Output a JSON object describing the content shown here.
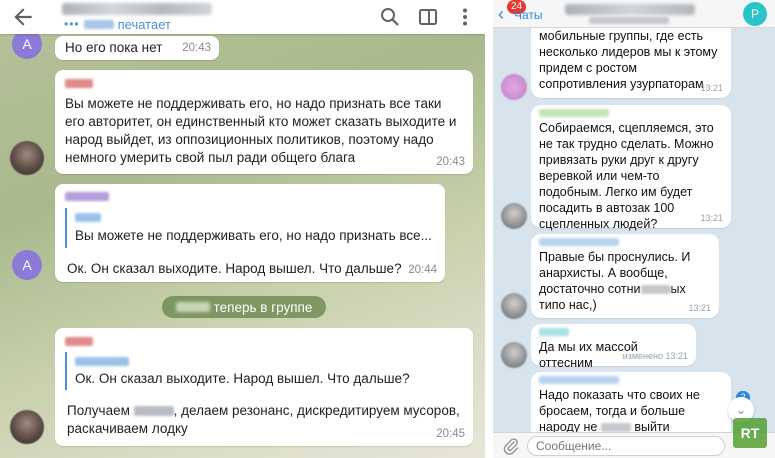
{
  "left": {
    "header": {
      "typing_label": "печатает",
      "icons": [
        "back-arrow-icon",
        "search-icon",
        "sidebar-icon",
        "more-vert-icon"
      ]
    },
    "messages": [
      {
        "avatar": "A",
        "text": "Но его пока нет",
        "time": "20:43"
      },
      {
        "text": "Вы можете не поддерживать его, но надо признать все таки его авторитет, он единственный кто может сказать выходите и народ выйдет, из оппозиционных политиков, поэтому надо немного умерить свой пыл ради общего блага",
        "time": "20:43"
      },
      {
        "avatar": "A",
        "quote": "Вы можете не поддерживать его, но надо признать все...",
        "text": "Ок. Он сказал выходите. Народ вышел. Что дальше?",
        "time": "20:44"
      },
      {
        "quote": "Ок. Он сказал выходите. Народ вышел. Что дальше?",
        "text_a": "Получаем",
        "text_b": ", делаем резонанс, дискредитируем мусоров, раскачиваем лодку",
        "time": "20:45"
      }
    ],
    "service": {
      "text": "теперь в группе"
    }
  },
  "right": {
    "header": {
      "back_label": "Чаты",
      "unread": "24",
      "avatar_letter": "Р"
    },
    "messages": [
      {
        "text": "мобильные группы, где есть несколько лидеров  мы к этому придем с ростом сопротивления узурпаторам",
        "time": "13:21"
      },
      {
        "text": "Собираемся, сцепляемся, это не так трудно сделать. Можно привязать руки друг к другу веревкой или чем-то подобным. Легко им будет посадить в автозак 100 сцепленных людей?",
        "time": "13:21"
      },
      {
        "text_a": "Правые бы проснулись. И анархисты. А вообще, достаточно сотни",
        "text_b": "ых типо нас,)",
        "time": "13:21"
      },
      {
        "text": "Да мы их массой оттесним",
        "time": "изменено 13:21"
      },
      {
        "text_a": "Надо показать что своих не бросаем, тогда и больше народу не",
        "text_b": "выйти"
      }
    ],
    "scroll_count": "2",
    "input_placeholder": "Сообщение...",
    "watermark": "RT"
  },
  "colors": {
    "accent_blue": "#2d8ae0",
    "badge_red": "#e53935",
    "avatar_purple": "#8c7bd6",
    "service_green": "#708c56",
    "avatar_teal": "#29c4c9"
  }
}
